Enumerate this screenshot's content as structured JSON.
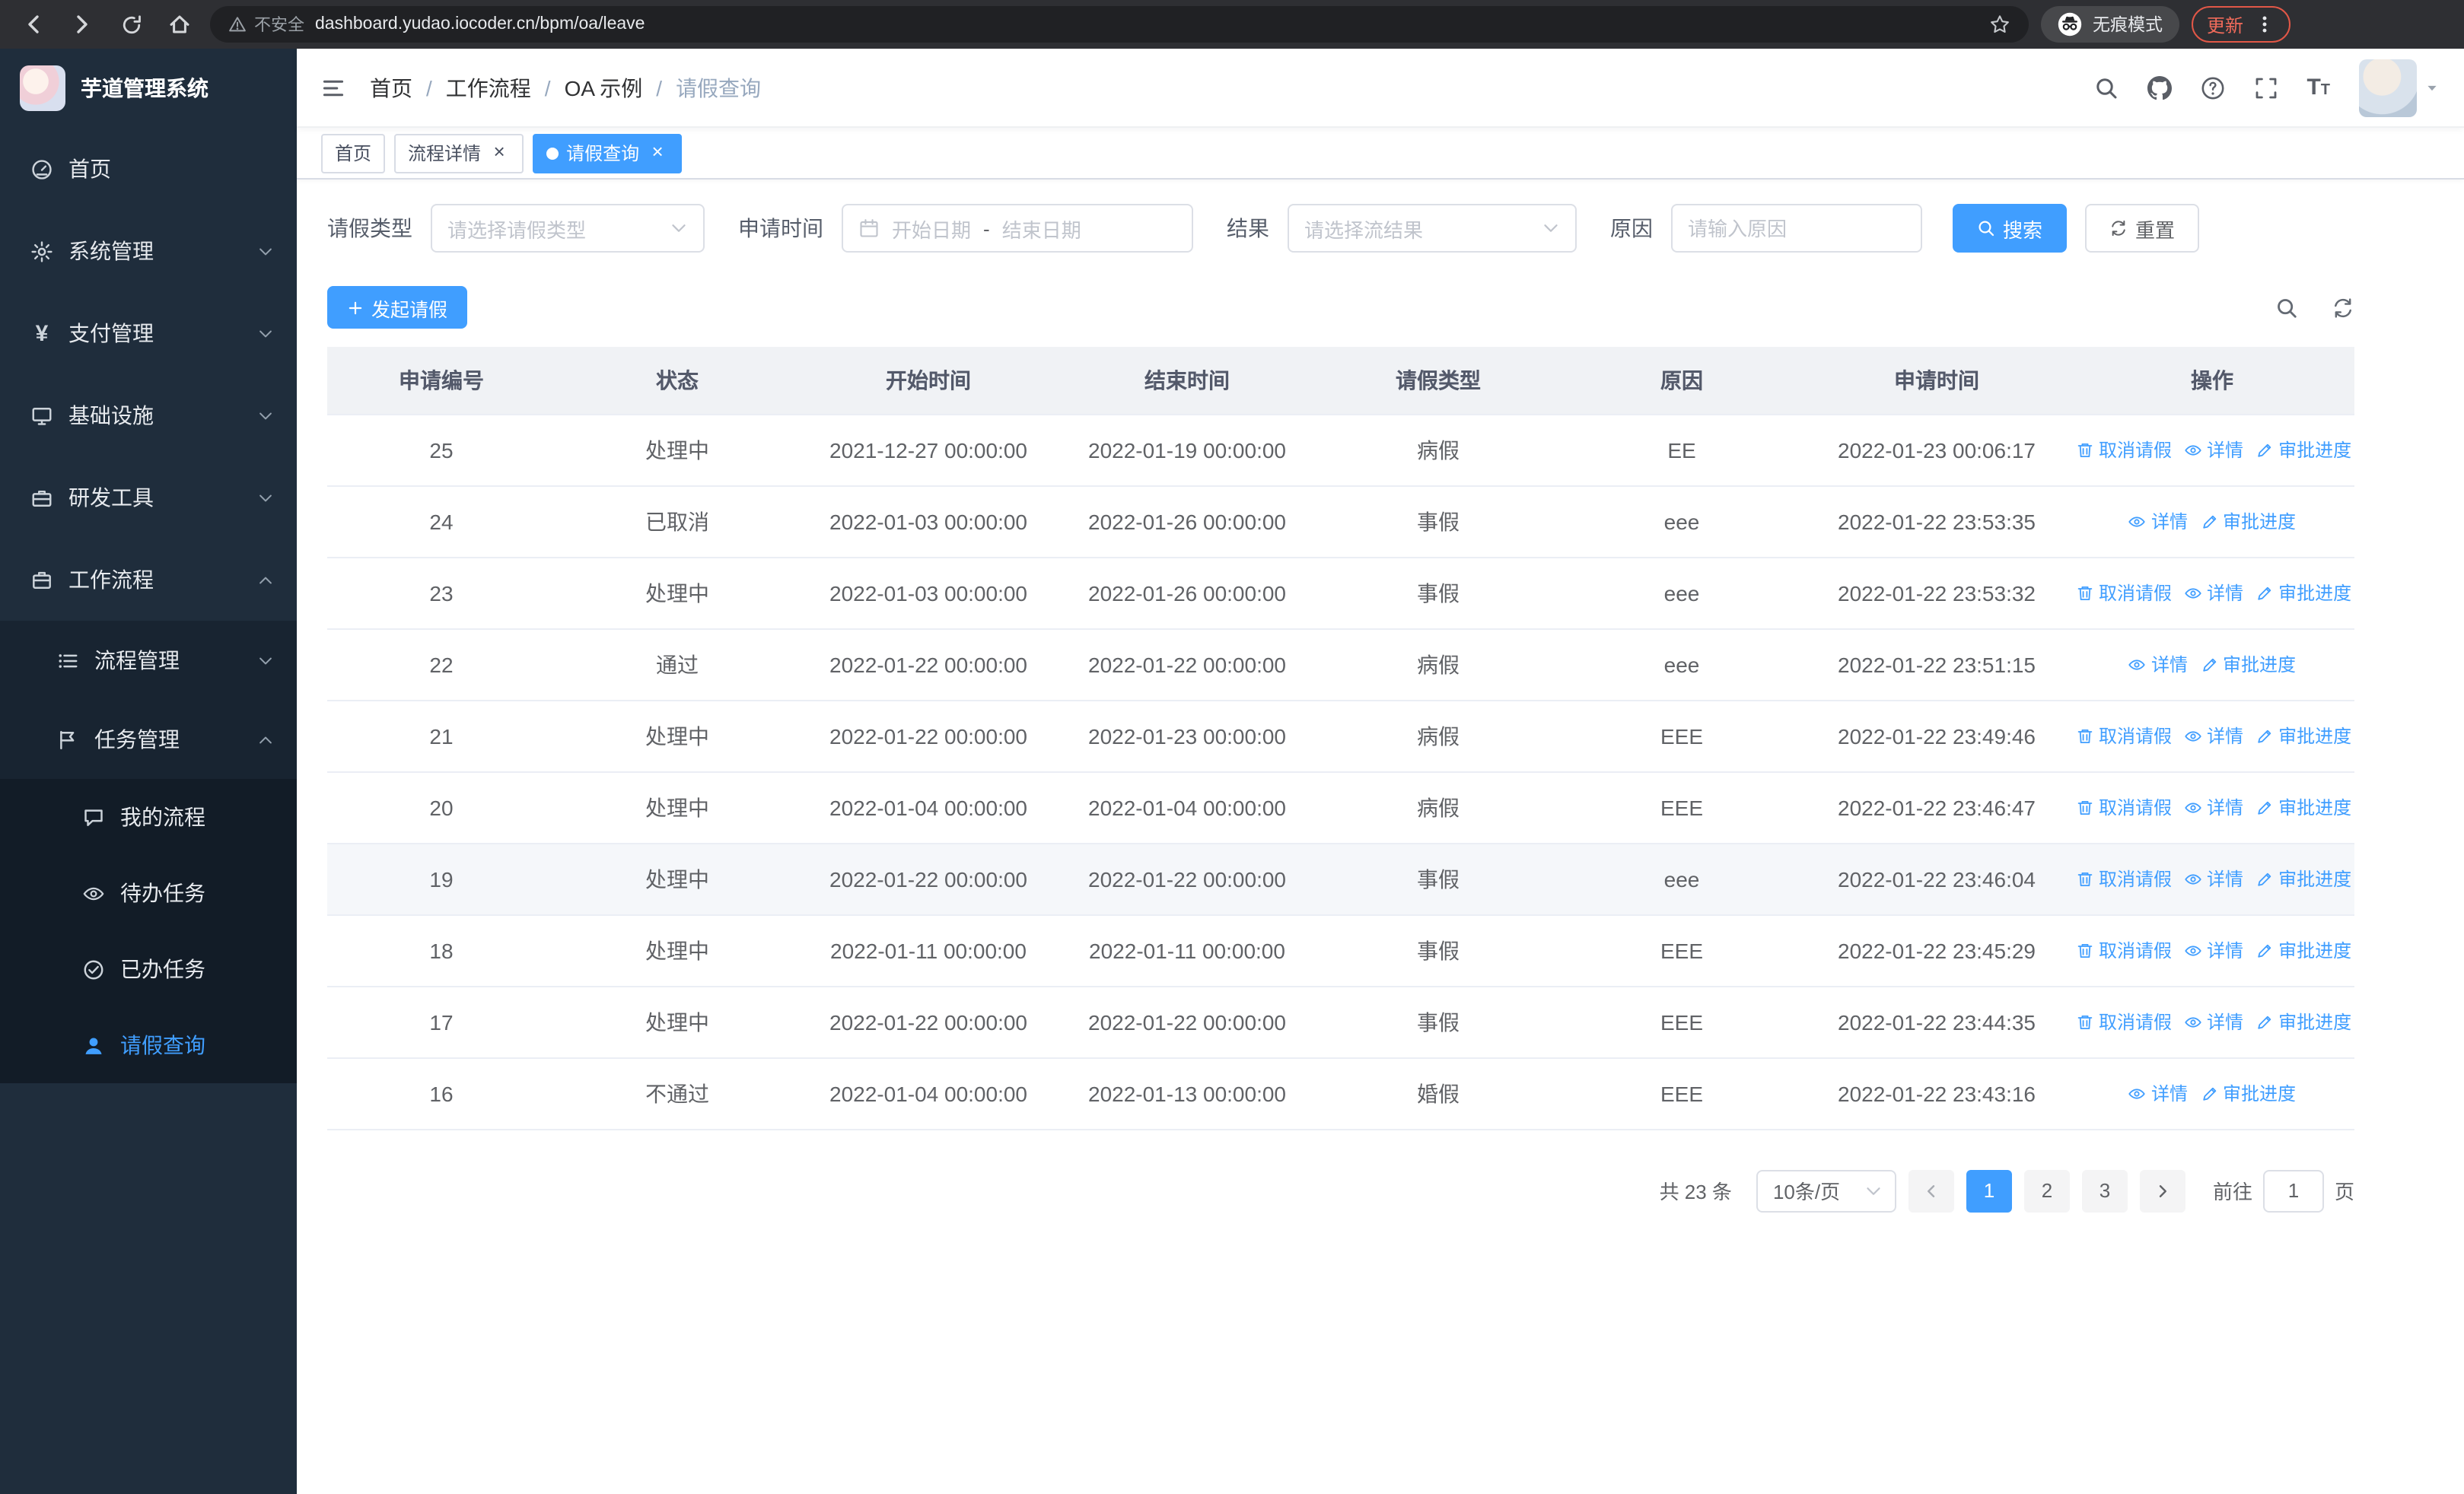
{
  "colors": {
    "primary": "#409eff",
    "sidebar_bg": "#1f2d3c",
    "sidebar_submenu_bg": "#121c27",
    "table_header_bg": "#f0f2f5",
    "update_badge": "#ef6a5a"
  },
  "browser": {
    "security_warning": "不安全",
    "url": "dashboard.yudao.iocoder.cn/bpm/oa/leave",
    "incognito_label": "无痕模式",
    "update_label": "更新"
  },
  "sidebar": {
    "logo_title": "芋道管理系统",
    "items": [
      {
        "key": "home",
        "label": "首页",
        "icon": "dashboard-icon",
        "level": 1
      },
      {
        "key": "system-management",
        "label": "系统管理",
        "icon": "gear-icon",
        "level": 1,
        "chevron": "down"
      },
      {
        "key": "payment-management",
        "label": "支付管理",
        "icon": "yen-icon",
        "level": 1,
        "chevron": "down"
      },
      {
        "key": "infrastructure",
        "label": "基础设施",
        "icon": "infra-icon",
        "level": 1,
        "chevron": "down"
      },
      {
        "key": "dev-tools",
        "label": "研发工具",
        "icon": "tools-icon",
        "level": 1,
        "chevron": "down"
      },
      {
        "key": "workflow",
        "label": "工作流程",
        "icon": "briefcase-icon",
        "level": 1,
        "chevron": "up"
      },
      {
        "key": "process-management",
        "label": "流程管理",
        "icon": "list-icon",
        "level": 2,
        "chevron": "down"
      },
      {
        "key": "task-management",
        "label": "任务管理",
        "icon": "flag-icon",
        "level": 2,
        "chevron": "up"
      },
      {
        "key": "my-process",
        "label": "我的流程",
        "icon": "chat-icon",
        "level": 3
      },
      {
        "key": "todo-tasks",
        "label": "待办任务",
        "icon": "eye-icon",
        "level": 3
      },
      {
        "key": "done-tasks",
        "label": "已办任务",
        "icon": "check-icon",
        "level": 3
      },
      {
        "key": "leave-query",
        "label": "请假查询",
        "icon": "user-icon",
        "level": 3,
        "active": true
      }
    ]
  },
  "header": {
    "breadcrumb": [
      "首页",
      "工作流程",
      "OA 示例",
      "请假查询"
    ]
  },
  "tabs": [
    {
      "key": "home",
      "label": "首页",
      "closable": false,
      "active": false
    },
    {
      "key": "process-detail",
      "label": "流程详情",
      "closable": true,
      "active": false
    },
    {
      "key": "leave-query",
      "label": "请假查询",
      "closable": true,
      "active": true
    }
  ],
  "filters": {
    "leave_type_label": "请假类型",
    "leave_type_placeholder": "请选择请假类型",
    "apply_time_label": "申请时间",
    "date_start_placeholder": "开始日期",
    "date_separator": "-",
    "date_end_placeholder": "结束日期",
    "result_label": "结果",
    "result_placeholder": "请选择流结果",
    "reason_label": "原因",
    "reason_placeholder": "请输入原因",
    "search_label": "搜索",
    "reset_label": "重置"
  },
  "toolbar": {
    "create_label": "发起请假"
  },
  "table": {
    "columns": [
      "申请编号",
      "状态",
      "开始时间",
      "结束时间",
      "请假类型",
      "原因",
      "申请时间",
      "操作"
    ],
    "action_labels": {
      "cancel": "取消请假",
      "detail": "详情",
      "progress": "审批进度"
    },
    "rows": [
      {
        "id": "25",
        "status": "处理中",
        "start": "2021-12-27 00:00:00",
        "end": "2022-01-19 00:00:00",
        "type": "病假",
        "reason": "EE",
        "applied": "2022-01-23 00:06:17",
        "actions": [
          "cancel",
          "detail",
          "progress"
        ]
      },
      {
        "id": "24",
        "status": "已取消",
        "start": "2022-01-03 00:00:00",
        "end": "2022-01-26 00:00:00",
        "type": "事假",
        "reason": "eee",
        "applied": "2022-01-22 23:53:35",
        "actions": [
          "detail",
          "progress"
        ]
      },
      {
        "id": "23",
        "status": "处理中",
        "start": "2022-01-03 00:00:00",
        "end": "2022-01-26 00:00:00",
        "type": "事假",
        "reason": "eee",
        "applied": "2022-01-22 23:53:32",
        "actions": [
          "cancel",
          "detail",
          "progress"
        ]
      },
      {
        "id": "22",
        "status": "通过",
        "start": "2022-01-22 00:00:00",
        "end": "2022-01-22 00:00:00",
        "type": "病假",
        "reason": "eee",
        "applied": "2022-01-22 23:51:15",
        "actions": [
          "detail",
          "progress"
        ]
      },
      {
        "id": "21",
        "status": "处理中",
        "start": "2022-01-22 00:00:00",
        "end": "2022-01-23 00:00:00",
        "type": "病假",
        "reason": "EEE",
        "applied": "2022-01-22 23:49:46",
        "actions": [
          "cancel",
          "detail",
          "progress"
        ]
      },
      {
        "id": "20",
        "status": "处理中",
        "start": "2022-01-04 00:00:00",
        "end": "2022-01-04 00:00:00",
        "type": "病假",
        "reason": "EEE",
        "applied": "2022-01-22 23:46:47",
        "actions": [
          "cancel",
          "detail",
          "progress"
        ]
      },
      {
        "id": "19",
        "status": "处理中",
        "start": "2022-01-22 00:00:00",
        "end": "2022-01-22 00:00:00",
        "type": "事假",
        "reason": "eee",
        "applied": "2022-01-22 23:46:04",
        "actions": [
          "cancel",
          "detail",
          "progress"
        ],
        "highlight": true
      },
      {
        "id": "18",
        "status": "处理中",
        "start": "2022-01-11 00:00:00",
        "end": "2022-01-11 00:00:00",
        "type": "事假",
        "reason": "EEE",
        "applied": "2022-01-22 23:45:29",
        "actions": [
          "cancel",
          "detail",
          "progress"
        ]
      },
      {
        "id": "17",
        "status": "处理中",
        "start": "2022-01-22 00:00:00",
        "end": "2022-01-22 00:00:00",
        "type": "事假",
        "reason": "EEE",
        "applied": "2022-01-22 23:44:35",
        "actions": [
          "cancel",
          "detail",
          "progress"
        ]
      },
      {
        "id": "16",
        "status": "不通过",
        "start": "2022-01-04 00:00:00",
        "end": "2022-01-13 00:00:00",
        "type": "婚假",
        "reason": "EEE",
        "applied": "2022-01-22 23:43:16",
        "actions": [
          "detail",
          "progress"
        ]
      }
    ]
  },
  "pagination": {
    "total_label": "共 23 条",
    "page_size_label": "10条/页",
    "pages": [
      "1",
      "2",
      "3"
    ],
    "active_page": "1",
    "goto_label": "前往",
    "goto_value": "1",
    "page_unit_label": "页"
  }
}
